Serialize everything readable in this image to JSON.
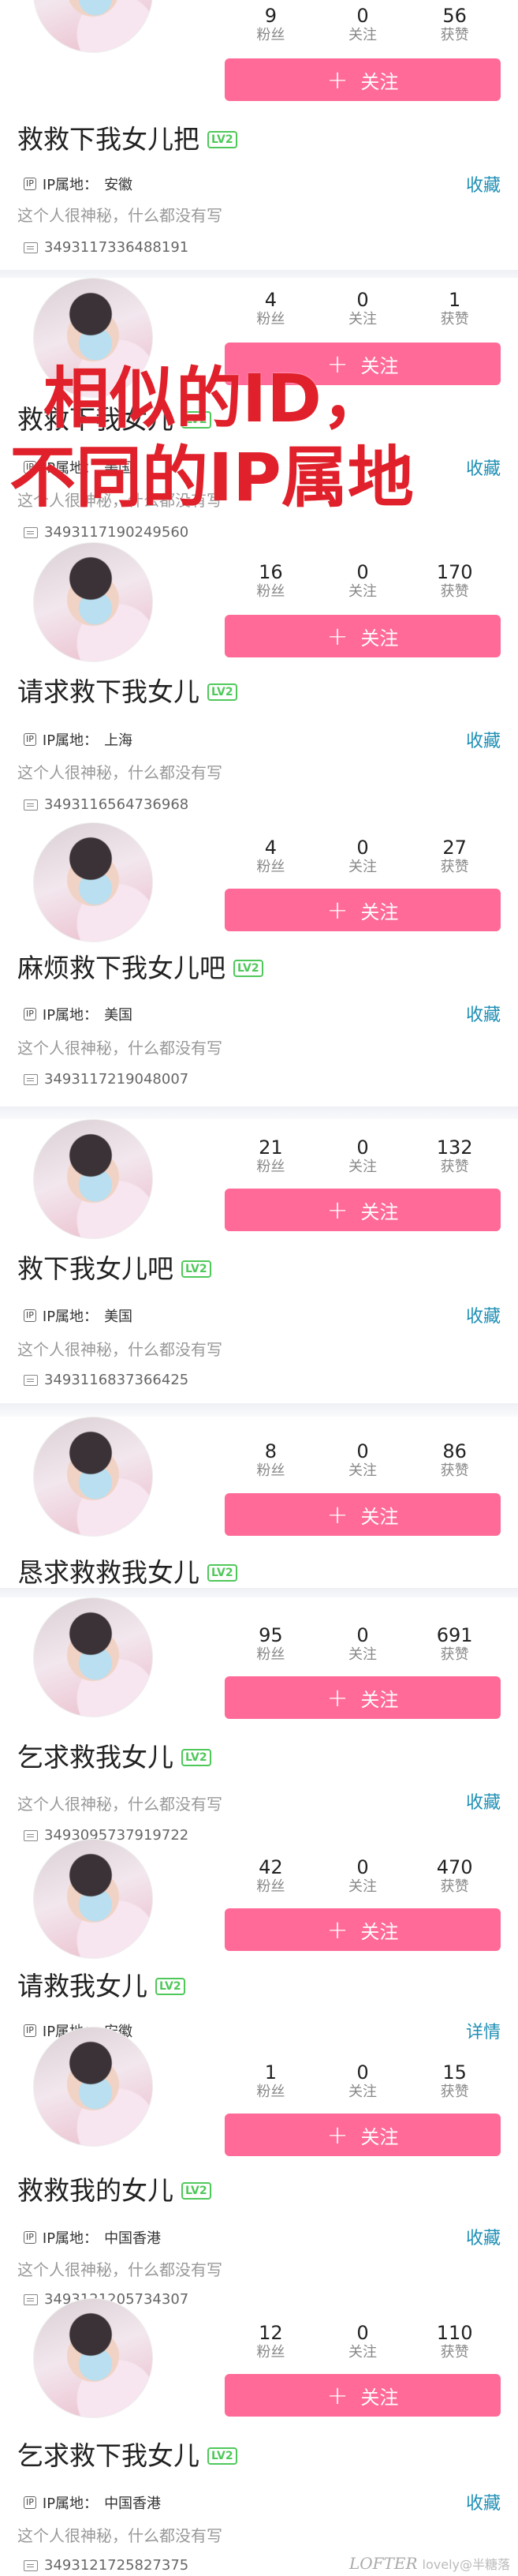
{
  "colors": {
    "accent": "#ff6a98",
    "link": "#1f8fb5",
    "level_badge": "#4fc85a",
    "overlay": "#e0202a"
  },
  "labels": {
    "fans": "粉丝",
    "following": "关注",
    "likes": "获赞",
    "follow_button": "关注",
    "ip_prefix": "IP属地：",
    "bio": "这个人很神秘，什么都没有写",
    "level": "LV2",
    "favorite": "收藏"
  },
  "overlay_text": [
    "相似的ID，",
    "不同的IP属地"
  ],
  "watermark": {
    "logo": "LOFTER",
    "text": "lovely@半糖落"
  },
  "profiles": [
    {
      "fans": "9",
      "following": "0",
      "likes": "56",
      "name": "救救下我女儿把",
      "ip": "安徽",
      "action": "收藏",
      "uid": "3493117336488191"
    },
    {
      "fans": "4",
      "following": "0",
      "likes": "1",
      "name": "救救下我女儿",
      "ip": "美国",
      "action": "收藏",
      "uid": "3493117190249560"
    },
    {
      "fans": "16",
      "following": "0",
      "likes": "170",
      "name": "请求救下我女儿",
      "ip": "上海",
      "action": "收藏",
      "uid": "3493116564736968"
    },
    {
      "fans": "4",
      "following": "0",
      "likes": "27",
      "name": "麻烦救下我女儿吧",
      "ip": "美国",
      "action": "收藏",
      "uid": "3493117219048007"
    },
    {
      "fans": "21",
      "following": "0",
      "likes": "132",
      "name": "救下我女儿吧",
      "ip": "美国",
      "action": "收藏",
      "uid": "3493116837366425"
    },
    {
      "fans": "8",
      "following": "0",
      "likes": "86",
      "name": "恳求救救我女儿",
      "ip": "",
      "action": "",
      "uid": ""
    },
    {
      "fans": "95",
      "following": "0",
      "likes": "691",
      "name": "乞求救我女儿",
      "ip": "",
      "action": "收藏",
      "uid": "3493095737919722"
    },
    {
      "fans": "42",
      "following": "0",
      "likes": "470",
      "name": "请救我女儿",
      "ip": "安徽",
      "action": "详情",
      "uid": ""
    },
    {
      "fans": "1",
      "following": "0",
      "likes": "15",
      "name": "救救我的女儿",
      "ip": "中国香港",
      "action": "收藏",
      "uid": "3493121205734307"
    },
    {
      "fans": "12",
      "following": "0",
      "likes": "110",
      "name": "乞求救下我女儿",
      "ip": "中国香港",
      "action": "收藏",
      "uid": "3493121725827375"
    }
  ]
}
